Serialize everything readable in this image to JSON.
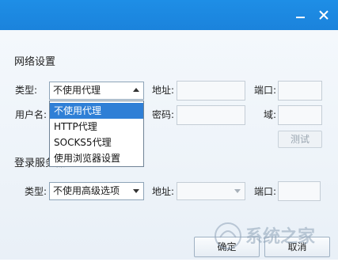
{
  "titlebar": {
    "icons": [
      "minimize-icon",
      "close-icon"
    ],
    "color": "#1e8ee6"
  },
  "proxy": {
    "section_title": "网络设置",
    "type_label": "类型:",
    "type_value": "不使用代理",
    "type_options": [
      "不使用代理",
      "HTTP代理",
      "SOCKS5代理",
      "使用浏览器设置"
    ],
    "selected_option": "不使用代理",
    "address_label": "地址:",
    "port_label": "端口:",
    "username_label": "用户名:",
    "password_label": "密码:",
    "domain_label": "域:",
    "test_button": "测试"
  },
  "login": {
    "section_title": "登录服务器",
    "type_label": "类型:",
    "type_value": "不使用高级选项",
    "address_label": "地址:",
    "port_label": "端口:"
  },
  "footer": {
    "ok_button": "确定",
    "cancel_button": "取消"
  },
  "watermark": {
    "text": "系统之家"
  }
}
